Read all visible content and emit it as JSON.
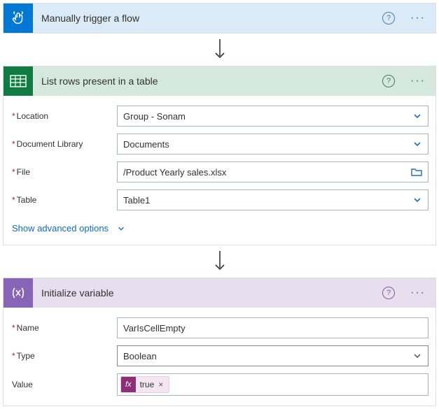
{
  "trigger": {
    "title": "Manually trigger a flow"
  },
  "excel": {
    "title": "List rows present in a table",
    "fields": {
      "location_label": "Location",
      "location_value": "Group - Sonam",
      "library_label": "Document Library",
      "library_value": "Documents",
      "file_label": "File",
      "file_value": "/Product Yearly sales.xlsx",
      "table_label": "Table",
      "table_value": "Table1"
    },
    "advanced_label": "Show advanced options"
  },
  "initvar": {
    "title": "Initialize variable",
    "fields": {
      "name_label": "Name",
      "name_value": "VarIsCellEmpty",
      "type_label": "Type",
      "type_value": "Boolean",
      "value_label": "Value",
      "value_token": "true"
    }
  },
  "icons": {
    "fx": "fx"
  }
}
